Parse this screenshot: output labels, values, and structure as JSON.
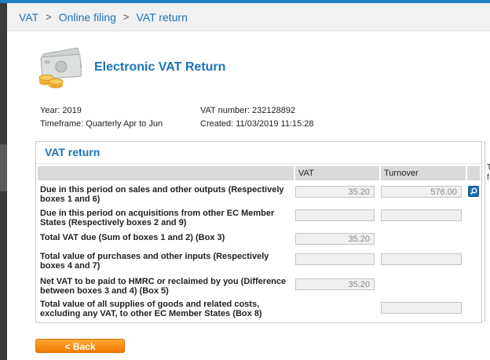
{
  "breadcrumb": {
    "items": [
      "VAT",
      "Online filing",
      "VAT return"
    ],
    "separator": ">"
  },
  "header": {
    "icon": "cash-money-icon",
    "title": "Electronic VAT Return"
  },
  "info": {
    "year": "Year: 2019",
    "timeframe": "Timeframe: Quarterly Apr to Jun",
    "vat_number": "VAT number: 232128892",
    "created": "Created: 11/03/2019 11:15:28"
  },
  "panel": {
    "title": "VAT return",
    "columns": {
      "vat": "VAT",
      "turnover": "Turnover"
    },
    "rows": [
      {
        "label": "Due in this period on sales and other outputs (Respectively boxes 1 and 6)",
        "vat": "35.20",
        "turnover": "576.00"
      },
      {
        "label": "Due in this period on acquisitions from other EC Member States (Respectively boxes 2 and 9)",
        "vat": "",
        "turnover": ""
      },
      {
        "label": "Total VAT due (Sum of boxes 1 and 2) (Box 3)",
        "vat": "35.20"
      },
      {
        "label": "Total value of purchases and other inputs (Respectively boxes 4 and 7)",
        "vat": "",
        "turnover": ""
      },
      {
        "label": "Net VAT to be paid to HMRC or reclaimed by you (Difference between boxes 3 and 4) (Box 5)",
        "vat": "35.20"
      },
      {
        "label": "Total value of all supplies of goods and related costs, excluding any VAT, to other EC Member States (Box 8)",
        "turnover": ""
      }
    ]
  },
  "side_panel": {
    "fragments": [
      "T",
      "f"
    ]
  },
  "actions": {
    "back_label": "< Back"
  },
  "colors": {
    "accent": "#1a73b8",
    "button": "#f28c1a",
    "header_row": "#d9d9d9"
  }
}
